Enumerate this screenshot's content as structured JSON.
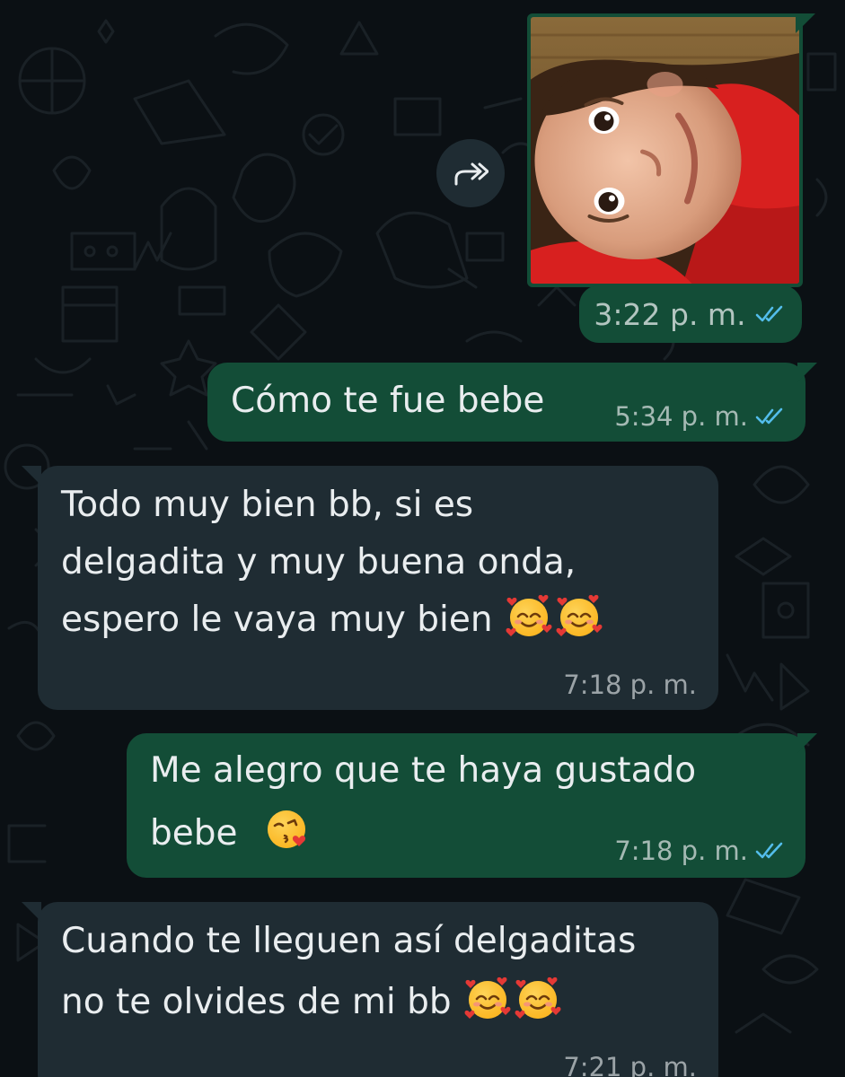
{
  "colors": {
    "background": "#0b1014",
    "incoming_bubble": "#1f2c33",
    "outgoing_bubble": "#134d37",
    "read_ticks": "#53bdeb"
  },
  "messages": [
    {
      "direction": "outgoing",
      "type": "image",
      "image_alt": "photo of a smiling child in a red shirt",
      "time": "3:22 p. m.",
      "status": "read",
      "status_icon": "double-check-icon"
    },
    {
      "direction": "outgoing",
      "type": "text",
      "lines": [
        "Cómo te fue bebe"
      ],
      "time": "5:34 p. m.",
      "status": "read",
      "status_icon": "double-check-icon"
    },
    {
      "direction": "incoming",
      "type": "text",
      "lines": [
        "Todo muy bien bb, si es",
        "delgadita y muy buena onda,",
        "espero le vaya muy bien"
      ],
      "emojis": [
        "smiling-face-with-hearts",
        "smiling-face-with-hearts"
      ],
      "time": "7:18 p. m."
    },
    {
      "direction": "outgoing",
      "type": "text",
      "lines": [
        "Me alegro que te haya gustado",
        "bebe"
      ],
      "emojis": [
        "face-blowing-a-kiss"
      ],
      "time": "7:18 p. m.",
      "status": "read",
      "status_icon": "double-check-icon"
    },
    {
      "direction": "incoming",
      "type": "text",
      "lines": [
        "Cuando te lleguen así delgaditas",
        "no te olvides de mi bb"
      ],
      "emojis": [
        "smiling-face-with-hearts",
        "smiling-face-with-hearts"
      ],
      "time": "7:21 p. m."
    }
  ],
  "forward_icon": "forward-icon"
}
